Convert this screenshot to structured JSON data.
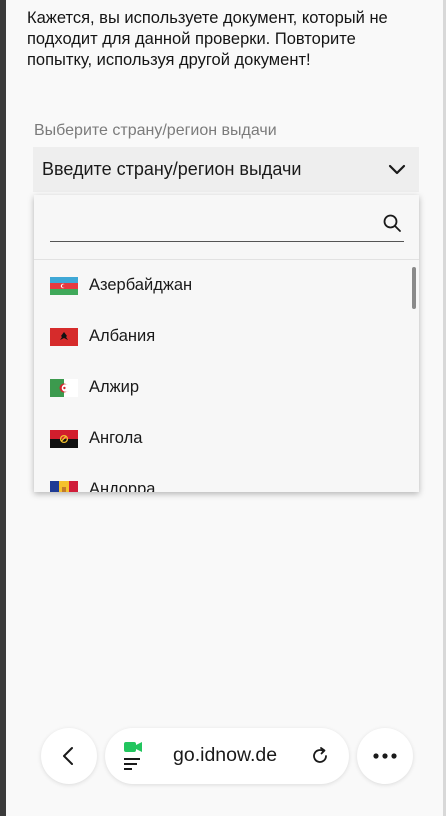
{
  "message": "Кажется, вы используете документ, который не подходит для данной проверки. Повторите попытку, используя другой документ!",
  "country_select": {
    "label": "Выберите страну/регион выдачи",
    "value": "Введите страну/регион выдачи"
  },
  "dropdown": {
    "search_placeholder": "",
    "items": [
      {
        "label": "Азербайджан",
        "flag": "azerbaijan-flag"
      },
      {
        "label": "Албания",
        "flag": "albania-flag"
      },
      {
        "label": "Алжир",
        "flag": "algeria-flag"
      },
      {
        "label": "Ангола",
        "flag": "angola-flag"
      },
      {
        "label": "Андорра",
        "flag": "andorra-flag"
      }
    ]
  },
  "browser_bar": {
    "url": "go.idnow.de"
  },
  "colors": {
    "camera_icon": "#22c55e",
    "select_bg": "#eeeeee"
  }
}
